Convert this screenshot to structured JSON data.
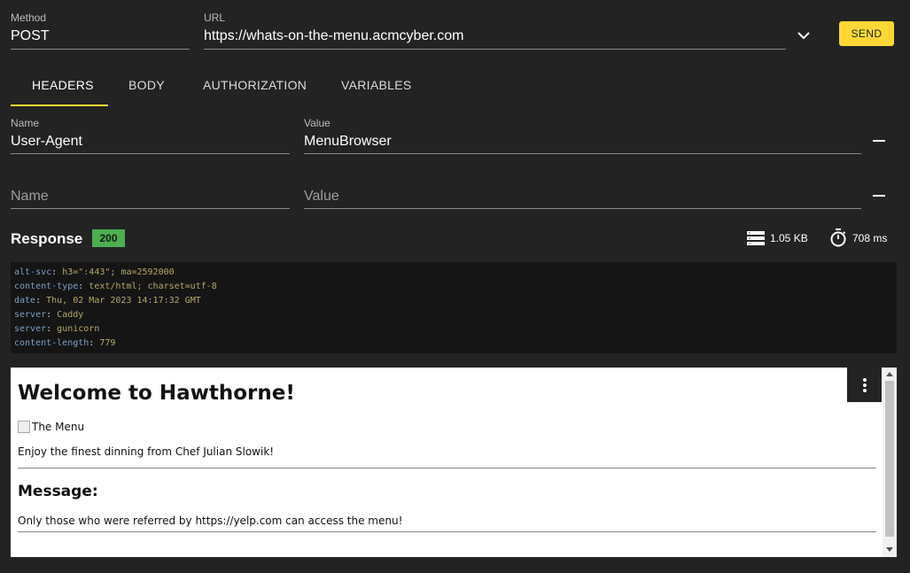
{
  "request": {
    "method_label": "Method",
    "method_value": "POST",
    "url_label": "URL",
    "url_value": "https://whats-on-the-menu.acmcyber.com",
    "send_label": "SEND"
  },
  "tabs": [
    {
      "label": "HEADERS",
      "active": true
    },
    {
      "label": "BODY",
      "active": false
    },
    {
      "label": "AUTHORIZATION",
      "active": false
    },
    {
      "label": "VARIABLES",
      "active": false
    }
  ],
  "headers": [
    {
      "name_label": "Name",
      "name": "User-Agent",
      "value_label": "Value",
      "value": "MenuBrowser"
    },
    {
      "name_placeholder": "Name",
      "value_placeholder": "Value"
    }
  ],
  "response": {
    "title": "Response",
    "status": "200",
    "size": "1.05 KB",
    "time": "708 ms",
    "headers": [
      {
        "key": "alt-svc",
        "value": "h3=\":443\"; ma=2592000"
      },
      {
        "key": "content-type",
        "value": "text/html; charset=utf-8"
      },
      {
        "key": "date",
        "value": "Thu, 02 Mar 2023 14:17:32 GMT"
      },
      {
        "key": "server",
        "value": "Caddy"
      },
      {
        "key": "server",
        "value": "gunicorn"
      },
      {
        "key": "content-length",
        "value": "779"
      }
    ]
  },
  "preview": {
    "heading": "Welcome to Hawthorne!",
    "image_alt": "The Menu",
    "intro": "Enjoy the finest dinning from Chef Julian Slowik!",
    "message_heading": "Message:",
    "message": "Only those who were referred by https://yelp.com can access the menu!"
  },
  "colors": {
    "background": "#232323",
    "accent": "#fdd835",
    "status_ok": "#4caf50",
    "header_key": "#7a9fc7",
    "header_value": "#b5a86a"
  },
  "icons": [
    "chevron-down-icon",
    "storage-icon",
    "timer-icon",
    "more-vert-icon"
  ]
}
